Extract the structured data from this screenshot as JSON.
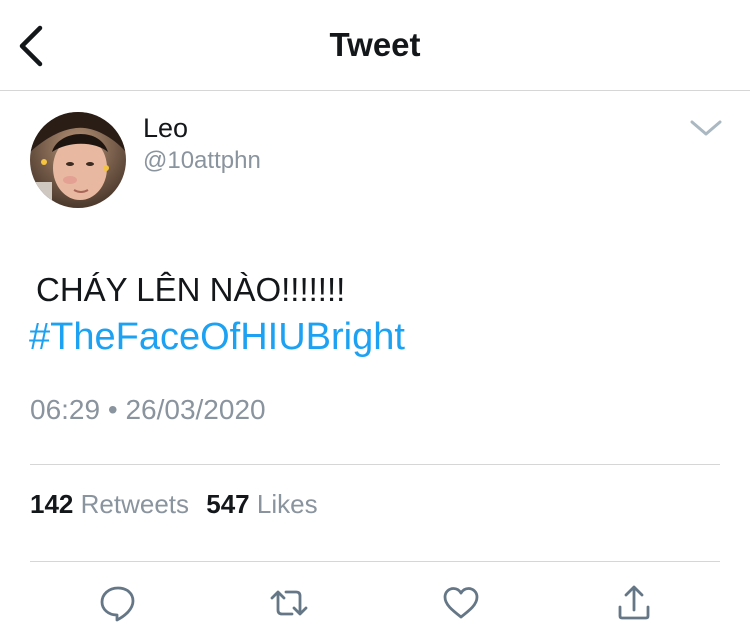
{
  "header": {
    "title": "Tweet",
    "back_icon": "chevron-left-icon"
  },
  "tweet": {
    "author": {
      "display_name": "Leo",
      "handle": "@10attphn"
    },
    "menu_icon": "chevron-down-icon",
    "text": "CHÁY LÊN NÀO!!!!!!!",
    "hashtag": "#TheFaceOfHIUBright",
    "time": "06:29",
    "separator": "•",
    "date": "26/03/2020",
    "stats": {
      "retweets_count": "142",
      "retweets_label": "Retweets",
      "likes_count": "547",
      "likes_label": "Likes"
    },
    "actions": [
      "reply-icon",
      "retweet-icon",
      "like-icon",
      "share-icon"
    ]
  },
  "colors": {
    "link": "#1da1f2",
    "secondary_text": "#8a949e",
    "primary_text": "#14171a",
    "icon": "#657786",
    "divider": "#d6d6d6"
  }
}
